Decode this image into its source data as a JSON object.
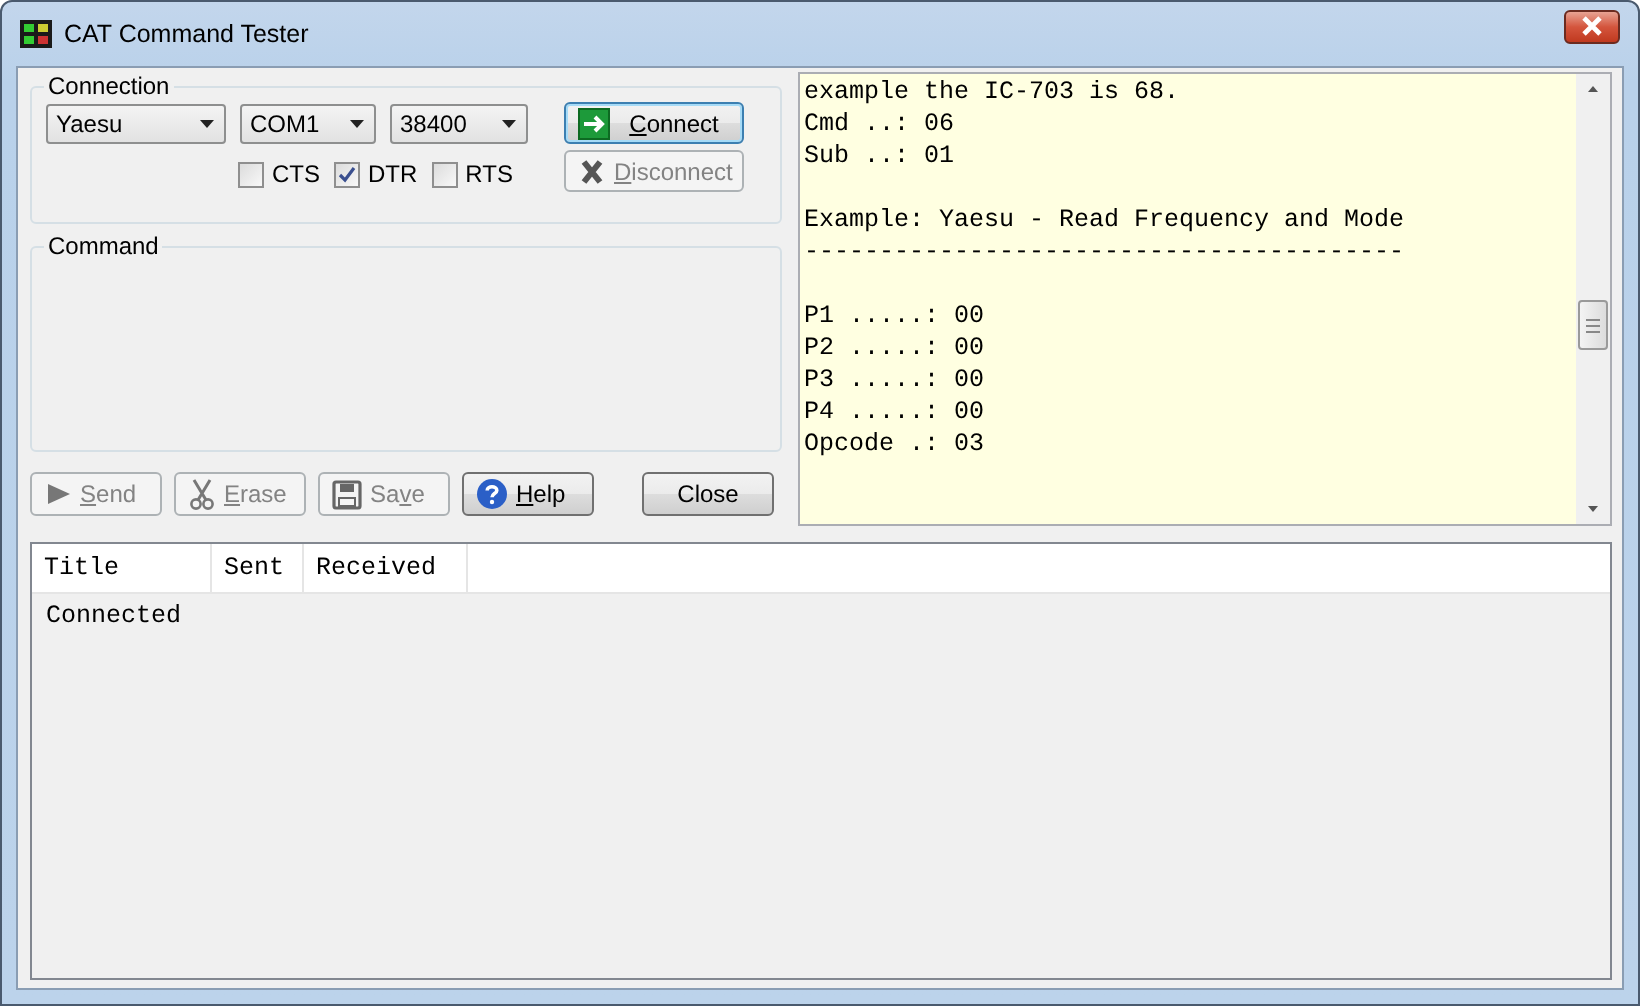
{
  "window": {
    "title": "CAT Command Tester"
  },
  "connection": {
    "label": "Connection",
    "selects": [
      {
        "value": "Yaesu"
      },
      {
        "value": "COM1"
      },
      {
        "value": "38400"
      }
    ],
    "checkboxes": [
      {
        "label": "CTS",
        "checked": false
      },
      {
        "label": "DTR",
        "checked": true
      },
      {
        "label": "RTS",
        "checked": false
      }
    ],
    "buttons": [
      {
        "kind": "connect",
        "label": [
          {
            "text": "C",
            "underlined": true
          },
          {
            "text": "onnect",
            "underlined": false
          }
        ],
        "disabled": false,
        "default": true
      },
      {
        "kind": "disconnect",
        "label": [
          {
            "text": "D",
            "underlined": true
          },
          {
            "text": "isconnect",
            "underlined": false
          }
        ],
        "disabled": true,
        "default": false
      }
    ]
  },
  "command": {
    "label": "Command"
  },
  "actions": [
    {
      "kind": "send",
      "label": [
        {
          "text": "S",
          "underlined": true
        },
        {
          "text": "end",
          "underlined": false
        }
      ],
      "disabled": true
    },
    {
      "kind": "erase",
      "label": [
        {
          "text": "E",
          "underlined": true
        },
        {
          "text": "rase",
          "underlined": false
        }
      ],
      "disabled": true
    },
    {
      "kind": "save",
      "label": [
        {
          "text": "Sa",
          "underlined": false
        },
        {
          "text": "v",
          "underlined": true
        },
        {
          "text": "e",
          "underlined": false
        }
      ],
      "disabled": true
    },
    {
      "kind": "help",
      "label": [
        {
          "text": "H",
          "underlined": true
        },
        {
          "text": "elp",
          "underlined": false
        }
      ],
      "disabled": false
    },
    {
      "kind": "close",
      "label": [
        {
          "text": "Close",
          "underlined": false
        }
      ],
      "disabled": false
    }
  ],
  "memo": {
    "paragraphs": [
      [
        "example the IC-703 is 68.",
        "Cmd ..: 06",
        "Sub ..: 01"
      ],
      [
        "Example: Yaesu - Read Frequency and Mode",
        "----------------------------------------"
      ],
      [
        "P1 .....: 00",
        "P2 .....: 00",
        "P3 .....: 00",
        "P4 .....: 00",
        "Opcode .: 03"
      ]
    ]
  },
  "log": {
    "columns": [
      "Title",
      "Sent",
      "Received"
    ],
    "rows": [
      [
        "Connected"
      ]
    ]
  }
}
